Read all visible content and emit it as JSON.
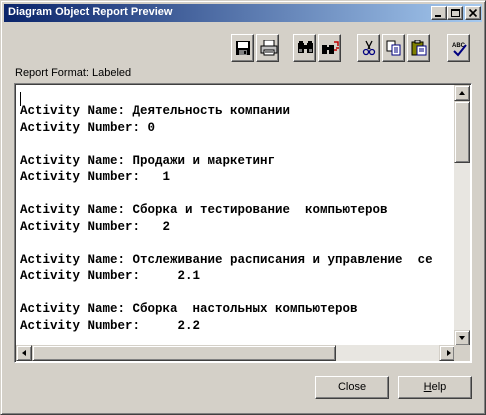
{
  "window": {
    "title": "Diagram Object Report Preview"
  },
  "titlebar_buttons": [
    "minimize-icon",
    "maximize-icon",
    "close-icon"
  ],
  "toolbar": {
    "groups": [
      [
        "save-icon",
        "print-icon"
      ],
      [
        "find-icon",
        "replace-icon"
      ],
      [
        "cut-icon",
        "copy-icon",
        "paste-icon"
      ],
      [
        "spell-check-icon"
      ]
    ],
    "spell_label": "ABC"
  },
  "report": {
    "format_label": "Report Format: Labeled",
    "lines": [
      "Activity Name: Деятельность компании",
      "Activity Number: 0",
      "",
      "Activity Name: Продажи и маркетинг",
      "Activity Number:   1",
      "",
      "Activity Name: Сборка и тестирование  компьютеров",
      "Activity Number:   2",
      "",
      "Activity Name: Отслеживание расписания и управление  се",
      "Activity Number:     2.1",
      "",
      "Activity Name: Сборка  настольных компьютеров",
      "Activity Number:     2.2"
    ]
  },
  "buttons": {
    "close": "Close",
    "help_mnemonic": "H",
    "help_rest": "elp"
  },
  "colors": {
    "title_start": "#0a246a",
    "title_end": "#a6caf0",
    "face": "#d4d0c8"
  }
}
